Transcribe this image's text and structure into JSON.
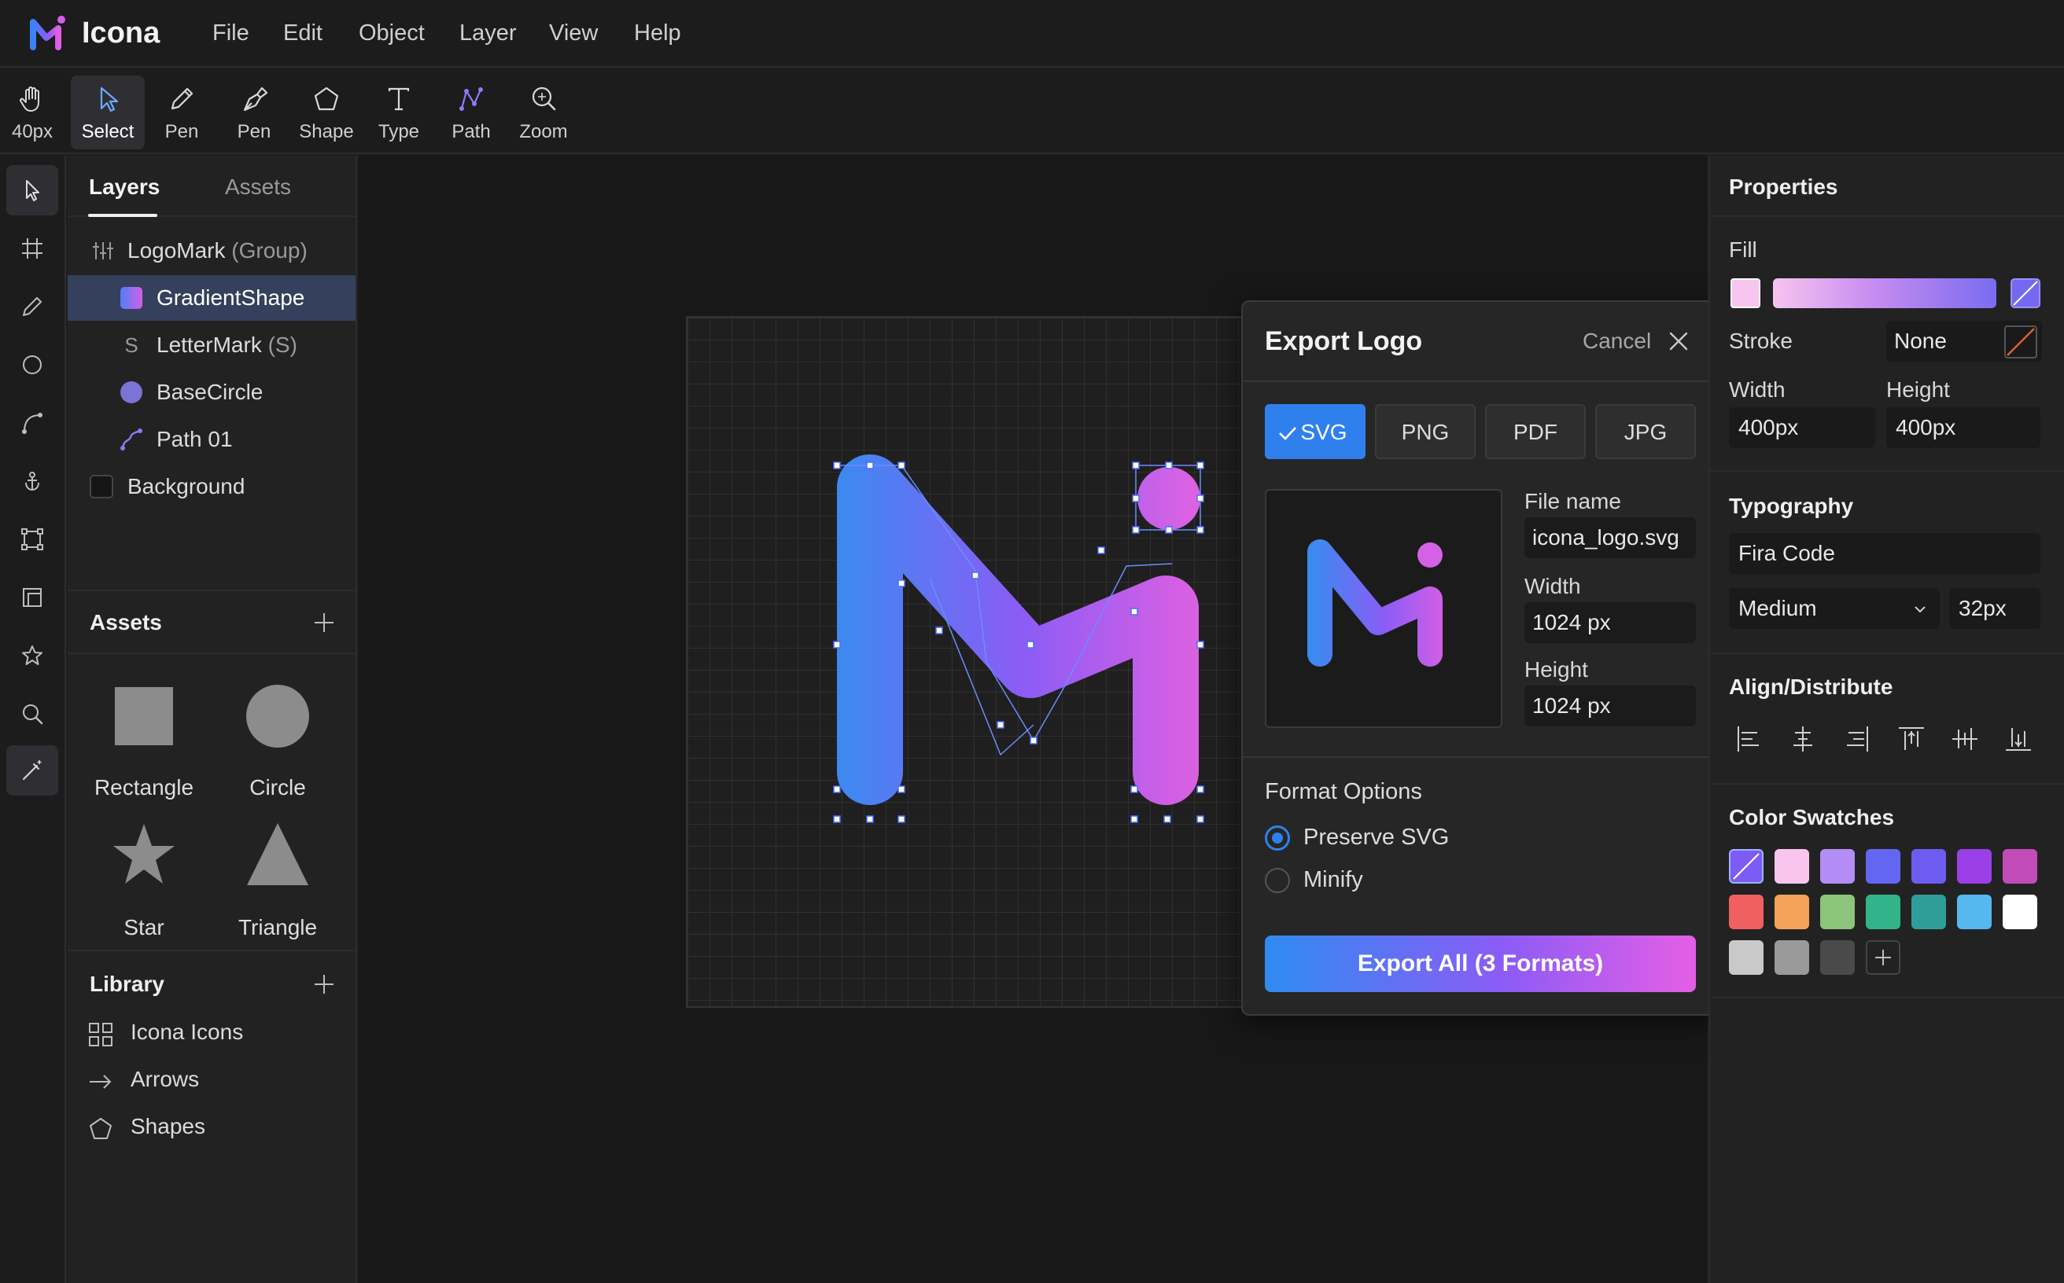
{
  "app": {
    "name": "Icona"
  },
  "menu": [
    "File",
    "Edit",
    "Object",
    "Layer",
    "View",
    "Help"
  ],
  "toolbar": {
    "tools": [
      {
        "label": "40px",
        "icon": "hand-icon"
      },
      {
        "label": "Select",
        "icon": "cursor-icon",
        "active": true
      },
      {
        "label": "Pen",
        "icon": "pencil-icon"
      },
      {
        "label": "Pen",
        "icon": "pen-nib-icon"
      },
      {
        "label": "Shape",
        "icon": "pentagon-icon"
      },
      {
        "label": "Type",
        "icon": "type-icon"
      },
      {
        "label": "Path",
        "icon": "path-icon"
      },
      {
        "label": "Zoom",
        "icon": "zoom-icon"
      }
    ]
  },
  "rail": [
    "select-tool-icon",
    "frame-icon",
    "pencil-icon",
    "circle-icon",
    "curve-icon",
    "anchor-icon",
    "transform-icon",
    "crop-icon",
    "star-icon",
    "search-icon",
    "magic-wand-icon"
  ],
  "layers_panel": {
    "tabs": [
      "Layers",
      "Assets"
    ],
    "active_tab": "Layers",
    "layers": [
      {
        "name": "LogoMark",
        "suffix": "(Group)",
        "icon": "group-icon"
      },
      {
        "name": "GradientShape",
        "suffix": "",
        "icon": "gradient-square-icon",
        "selected": true
      },
      {
        "name": "LetterMark",
        "suffix": "(S)",
        "icon": "letter-s-icon"
      },
      {
        "name": "BaseCircle",
        "suffix": "",
        "icon": "circle-fill-icon"
      },
      {
        "name": "Path 01",
        "suffix": "",
        "icon": "path-icon"
      },
      {
        "name": "Background",
        "suffix": "",
        "icon": "square-dark-icon"
      }
    ]
  },
  "assets": {
    "title": "Assets",
    "items": [
      {
        "label": "Rectangle",
        "icon": "rectangle-icon"
      },
      {
        "label": "Circle",
        "icon": "circle-icon"
      },
      {
        "label": "Star",
        "icon": "star-icon"
      },
      {
        "label": "Triangle",
        "icon": "triangle-icon"
      }
    ]
  },
  "library": {
    "title": "Library",
    "items": [
      {
        "label": "Icona Icons",
        "icon": "grid-icon"
      },
      {
        "label": "Arrows",
        "icon": "arrow-right-icon"
      },
      {
        "label": "Shapes",
        "icon": "pentagon-icon"
      }
    ]
  },
  "export_dialog": {
    "title": "Export Logo",
    "cancel": "Cancel",
    "formats": [
      {
        "label": "SVG",
        "selected": true
      },
      {
        "label": "PNG",
        "selected": false
      },
      {
        "label": "PDF",
        "selected": false
      },
      {
        "label": "JPG",
        "selected": false
      }
    ],
    "file_name_label": "File name",
    "file_name": "icona_logo.svg",
    "width_label": "Width",
    "width": "1024 px",
    "height_label": "Height",
    "height": "1024 px",
    "format_options_title": "Format Options",
    "options": [
      {
        "label": "Preserve SVG",
        "checked": true
      },
      {
        "label": "Minify",
        "checked": false
      }
    ],
    "export_button": "Export All (3 Formats)"
  },
  "properties": {
    "title": "Properties",
    "fill_label": "Fill",
    "stroke_label": "Stroke",
    "stroke_value": "None",
    "width_label": "Width",
    "width_value": "400px",
    "height_label": "Height",
    "height_value": "400px",
    "typography_title": "Typography",
    "font_family": "Fira Code",
    "font_weight": "Medium",
    "font_size": "32px",
    "align_title": "Align/Distribute",
    "swatches_title": "Color Swatches",
    "swatches": [
      "#7c5cf5",
      "#f9c5ef",
      "#b48cf5",
      "#6366f1",
      "#6d5cf0",
      "#9b3fe8",
      "#c24bb8",
      "#f06060",
      "#f5a25a",
      "#8bc47a",
      "#33b38a",
      "#2f9e9a",
      "#56b8ef",
      "#ffffff",
      "#c9c9c9",
      "#9a9a9a",
      "#4a4a4a"
    ]
  },
  "colors": {
    "accent": "#2f80ed",
    "gradient_start": "#2f8bf0",
    "gradient_mid": "#8b5cf6",
    "gradient_end": "#e55ee5"
  }
}
